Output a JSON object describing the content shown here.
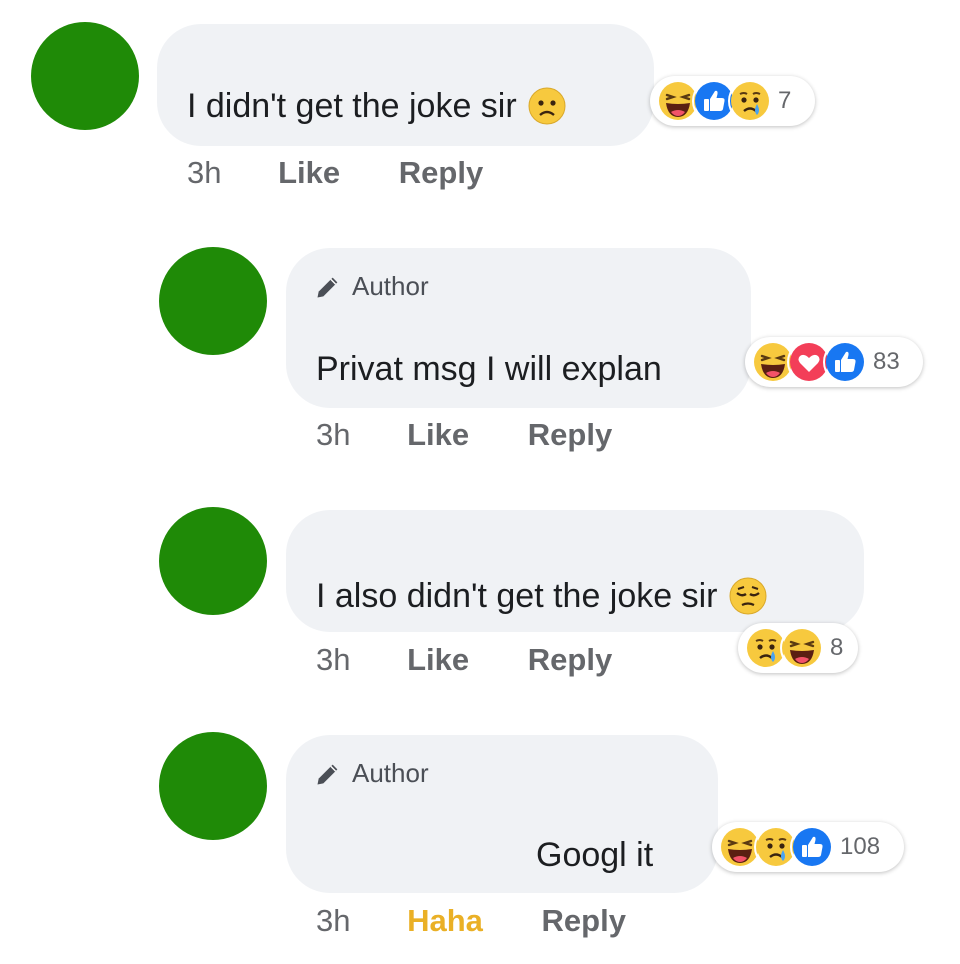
{
  "comments": [
    {
      "author_label": "",
      "text": "I didn't get the joke sir",
      "inline_emoji": "frowning-face-icon",
      "time": "3h",
      "like_label": "Like",
      "reply_label": "Reply",
      "reaction_count": "7",
      "reactions": [
        "haha-icon",
        "like-icon",
        "sad-icon"
      ]
    },
    {
      "author_label": "Author",
      "text": "Privat msg I will explan",
      "time": "3h",
      "like_label": "Like",
      "reply_label": "Reply",
      "reaction_count": "83",
      "reactions": [
        "haha-icon",
        "love-icon",
        "like-icon"
      ]
    },
    {
      "author_label": "",
      "text": "I also didn't get the joke sir",
      "inline_emoji": "pensive-face-icon",
      "time": "3h",
      "like_label": "Like",
      "reply_label": "Reply",
      "reaction_count": "8",
      "reactions": [
        "sad-icon",
        "haha-icon"
      ]
    },
    {
      "author_label": "Author",
      "text": "Googl it",
      "time": "3h",
      "like_label": "Haha",
      "reply_label": "Reply",
      "reaction_count": "108",
      "reactions": [
        "haha-icon",
        "sad-icon",
        "like-icon"
      ]
    }
  ],
  "colors": {
    "avatar": "#1f8a07",
    "bubble": "#f0f2f5",
    "haha_active": "#eab026",
    "like_blue": "#1877f2",
    "love_red": "#f33e58"
  }
}
